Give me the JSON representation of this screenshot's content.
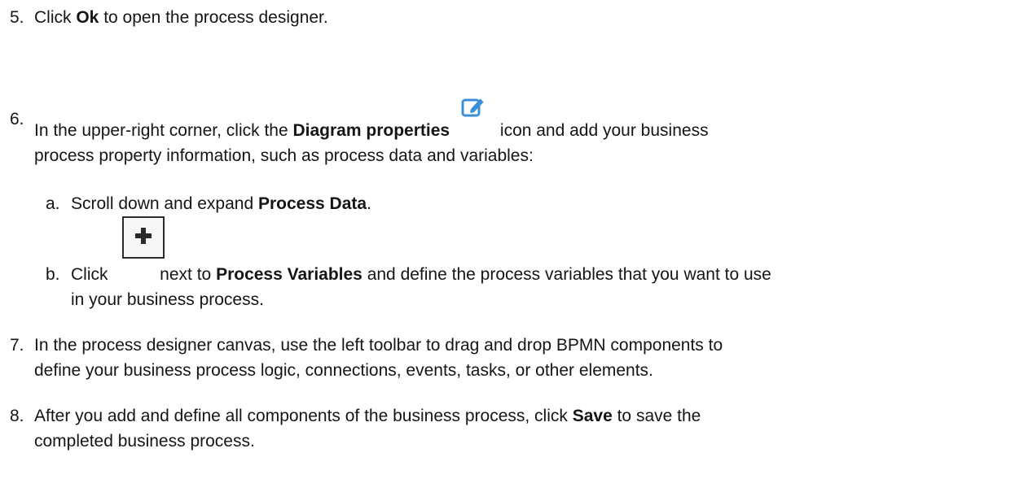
{
  "steps": [
    {
      "number": "5.",
      "before": "Click ",
      "bold": "Ok",
      "after": " to open the process designer."
    },
    {
      "number": "6.",
      "line1_before": "In the upper-right corner, click the ",
      "line1_bold": "Diagram properties",
      "line1_after": " icon and add your business",
      "line2": "process property information, such as process data and variables:",
      "icon": "edit-icon",
      "substeps": [
        {
          "letter": "a.",
          "before": "Scroll down and expand ",
          "bold": "Process Data",
          "after": "."
        },
        {
          "letter": "b.",
          "before": "Click ",
          "icon": "plus-icon",
          "middle": " next to ",
          "bold": "Process Variables",
          "after": " and define the process variables that you want to use",
          "line2": "in your business process."
        }
      ]
    },
    {
      "number": "7.",
      "line1": "In the process designer canvas, use the left toolbar to drag and drop BPMN components to",
      "line2": "define your business process logic, connections, events, tasks, or other elements."
    },
    {
      "number": "8.",
      "line1_before": "After you add and define all components of the business process, click ",
      "line1_bold": "Save",
      "line1_after": " to save the",
      "line2": "completed business process."
    }
  ],
  "colors": {
    "text": "#151515",
    "icon_blue": "#3b8fd6"
  }
}
